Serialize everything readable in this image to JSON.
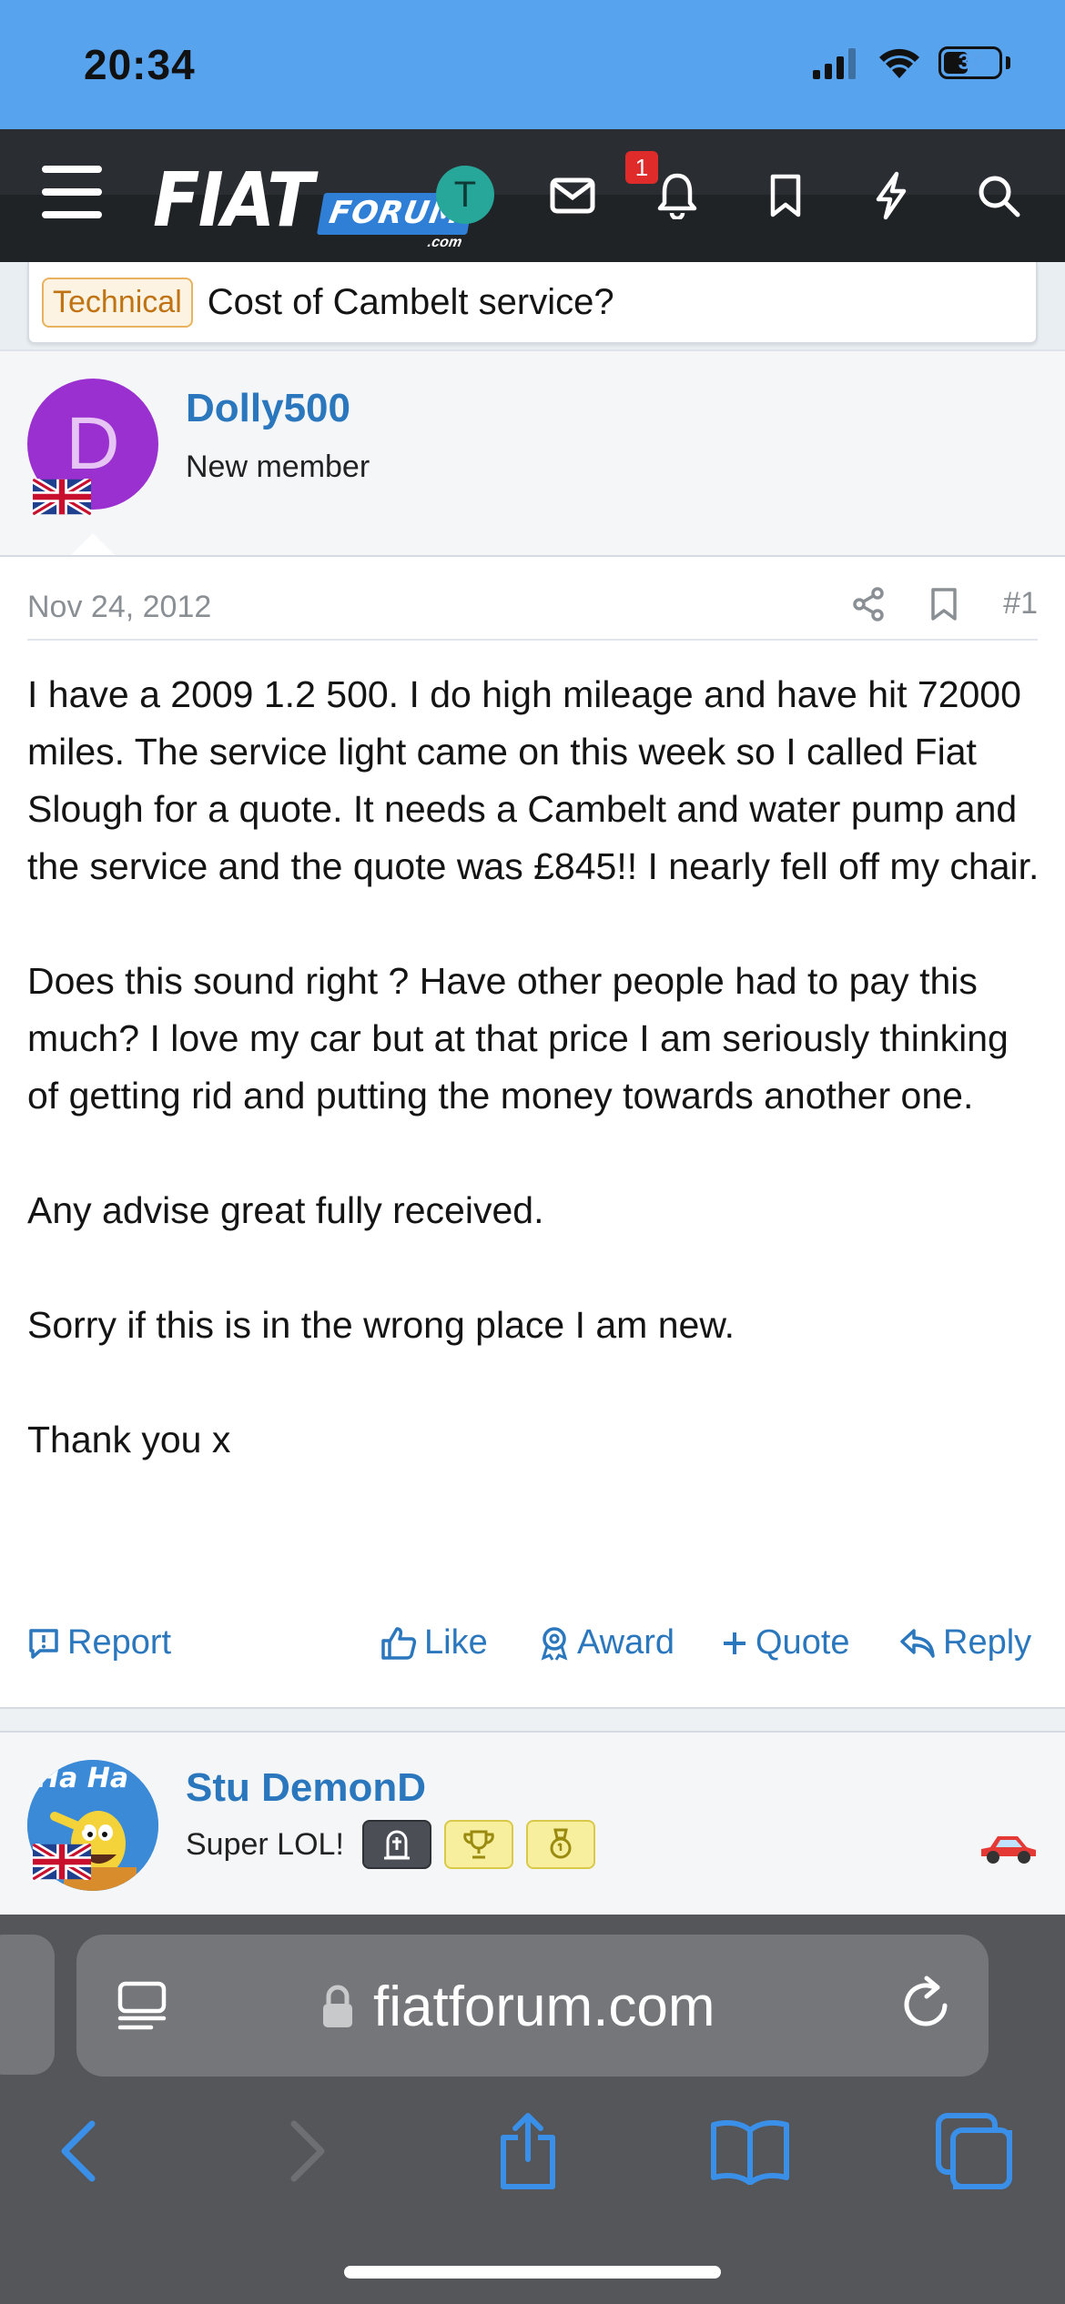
{
  "status_bar": {
    "time": "20:34",
    "battery": "37"
  },
  "header": {
    "logo_main": "FIAT",
    "logo_sub": "FORUM",
    "logo_domain": ".com",
    "user_initial": "T",
    "notification_count": "1"
  },
  "thread": {
    "prefix": "Technical",
    "title": "Cost of Cambelt service?"
  },
  "post1": {
    "avatar_initial": "D",
    "username": "Dolly500",
    "user_title": "New member",
    "date": "Nov 24, 2012",
    "post_number": "#1",
    "paragraphs": [
      "I have a 2009 1.2 500. I do high mileage and have hit 72000 miles. The service light came on this week so I called Fiat Slough for a quote. It needs a Cambelt and water pump and the service and the quote was £845!! I nearly fell off my chair.",
      "Does this sound right ? Have other people had to pay this much? I love my car but at that price I am seriously thinking of getting rid and putting the money towards another one.",
      "Any advise great fully received.",
      "Sorry if this is in the wrong place I am new.",
      "Thank you x"
    ],
    "actions": {
      "report": "Report",
      "like": "Like",
      "award": "Award",
      "quote": "Quote",
      "reply": "Reply"
    }
  },
  "post2": {
    "avatar_text": "Ha Ha",
    "username": "Stu DemonD",
    "user_title": "Super LOL!"
  },
  "browser": {
    "url": "fiatforum.com"
  },
  "colors": {
    "status_bar": "#57a3ee",
    "nav": "#1f2326",
    "link": "#2a77bd",
    "badge": "#e02b2b"
  }
}
